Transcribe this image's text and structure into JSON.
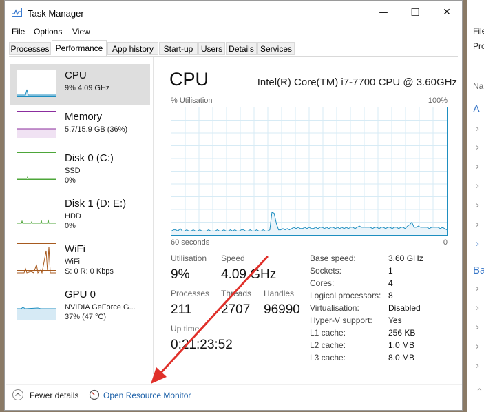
{
  "window": {
    "title": "Task Manager",
    "minimize_glyph": "—",
    "maximize_glyph": "☐",
    "close_glyph": "✕"
  },
  "menu": [
    "File",
    "Options",
    "View"
  ],
  "tabs": [
    "Processes",
    "Performance",
    "App history",
    "Start-up",
    "Users",
    "Details",
    "Services"
  ],
  "active_tab": "Performance",
  "sidebar": [
    {
      "name": "CPU",
      "line1": "9% 4.09 GHz",
      "line2": "",
      "icon": "cpu-thumbnail-graph",
      "color": "#1e8ec0"
    },
    {
      "name": "Memory",
      "line1": "5.7/15.9 GB (36%)",
      "line2": "",
      "icon": "memory-thumbnail-graph",
      "color": "#8b2d9e"
    },
    {
      "name": "Disk 0 (C:)",
      "line1": "SSD",
      "line2": "0%",
      "icon": "disk-thumbnail-graph",
      "color": "#4da639"
    },
    {
      "name": "Disk 1 (D: E:)",
      "line1": "HDD",
      "line2": "0%",
      "icon": "disk-thumbnail-graph",
      "color": "#4da639"
    },
    {
      "name": "WiFi",
      "line1": "WiFi",
      "line2": "S: 0  R: 0 Kbps",
      "icon": "wifi-thumbnail-graph",
      "color": "#a75a1f"
    },
    {
      "name": "GPU 0",
      "line1": "NVIDIA GeForce G...",
      "line2": "37% (47 °C)",
      "icon": "gpu-thumbnail-graph",
      "color": "#1e8ec0"
    }
  ],
  "main": {
    "title": "CPU",
    "model": "Intel(R) Core(TM) i7-7700 CPU @ 3.60GHz",
    "graph_label_left": "% Utilisation",
    "graph_label_right": "100%",
    "graph_time_left": "60 seconds",
    "graph_time_right": "0",
    "utilisation_label": "Utilisation",
    "utilisation_value": "9%",
    "speed_label": "Speed",
    "speed_value": "4.09 GHz",
    "processes_label": "Processes",
    "processes_value": "211",
    "threads_label": "Threads",
    "threads_value": "2707",
    "handles_label": "Handles",
    "handles_value": "96990",
    "uptime_label": "Up time",
    "uptime_value": "0:21:23:52",
    "specs": [
      {
        "k": "Base speed:",
        "v": "3.60 GHz"
      },
      {
        "k": "Sockets:",
        "v": "1"
      },
      {
        "k": "Cores:",
        "v": "4"
      },
      {
        "k": "Logical processors:",
        "v": "8"
      },
      {
        "k": "Virtualisation:",
        "v": "Disabled"
      },
      {
        "k": "Hyper-V support:",
        "v": "Yes"
      },
      {
        "k": "L1 cache:",
        "v": "256 KB"
      },
      {
        "k": "L2 cache:",
        "v": "1.0 MB"
      },
      {
        "k": "L3 cache:",
        "v": "8.0 MB"
      }
    ],
    "cpu_history_percent": [
      3,
      4,
      4,
      3,
      5,
      3,
      3,
      4,
      3,
      3,
      4,
      3,
      3,
      4,
      3,
      3,
      3,
      4,
      3,
      3,
      3,
      4,
      3,
      3,
      4,
      3,
      3,
      4,
      3,
      4,
      3,
      3,
      4,
      4,
      3,
      3,
      4,
      3,
      3,
      4,
      3,
      3,
      4,
      3,
      3,
      4,
      18,
      17,
      9,
      4,
      4,
      5,
      4,
      5,
      4,
      5,
      6,
      5,
      6,
      5,
      5,
      6,
      5,
      6,
      5,
      5,
      6,
      5,
      6,
      6,
      5,
      6,
      5,
      6,
      6,
      5,
      6,
      5,
      6,
      5,
      6,
      5,
      6,
      6,
      5,
      6,
      7,
      6,
      6,
      6,
      6,
      6,
      5,
      6,
      6,
      5,
      6,
      6,
      5,
      6,
      6,
      5,
      6,
      6,
      5,
      6,
      6,
      5,
      7,
      8,
      10,
      6,
      6,
      7,
      6,
      6,
      6,
      6,
      5,
      6,
      6,
      6,
      6,
      5,
      6,
      5,
      4
    ],
    "accent": "#1e8ec0"
  },
  "footer": {
    "fewer_details": "Fewer details",
    "open_resource_monitor": "Open Resource Monitor"
  },
  "background_window": {
    "labels": [
      "File",
      "Pro",
      "Na",
      "A",
      "Ba"
    ]
  },
  "annotation_color": "#e0302a"
}
